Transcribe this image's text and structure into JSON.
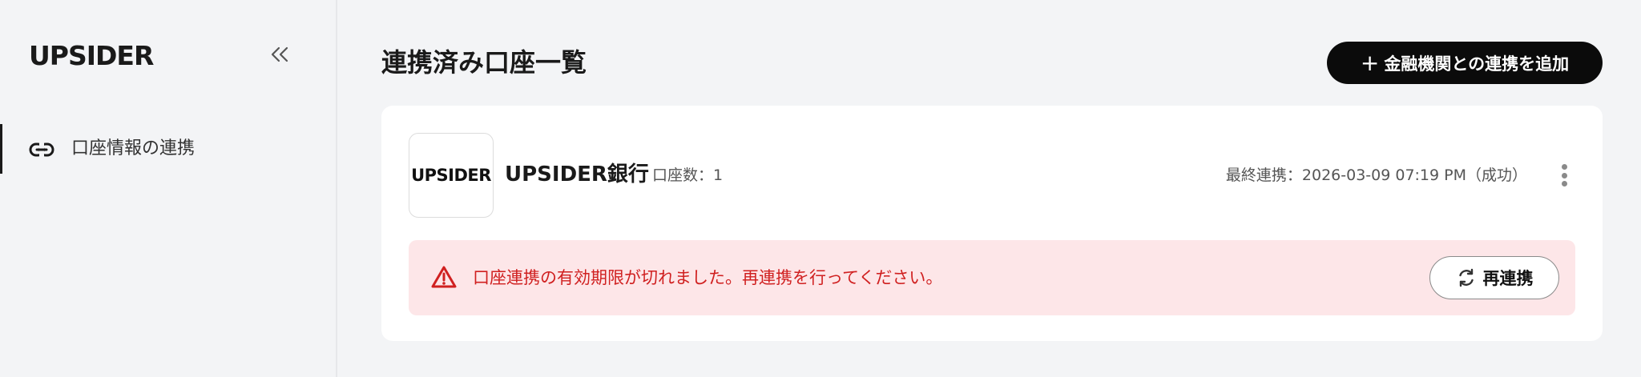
{
  "sidebar": {
    "logo": "UPSIDER",
    "collapse_icon": "double-chevron-left-icon",
    "items": [
      {
        "label": "口座情報の連携",
        "icon": "link-icon",
        "active": true
      }
    ]
  },
  "main": {
    "title": "連携済み口座一覧",
    "add_button": {
      "label": "金融機関との連携を追加",
      "icon": "plus-icon"
    }
  },
  "card": {
    "bank_logo_text": "UPSIDER",
    "bank_name": "UPSIDER銀行",
    "account_count": "口座数：1",
    "last_sync": "最終連携：2026-03-09 07:19 PM（成功）",
    "more_icon": "vertical-dots-icon",
    "alert": {
      "icon": "warning-triangle-icon",
      "message": "口座連携の有効期限が切れました。再連携を行ってください。",
      "relink_label": "再連携",
      "relink_icon": "refresh-icon"
    }
  },
  "colors": {
    "background": "#f3f4f6",
    "accent_dark": "#0b0b0b",
    "alert_bg": "#fde6e8",
    "alert_text": "#d02020"
  }
}
